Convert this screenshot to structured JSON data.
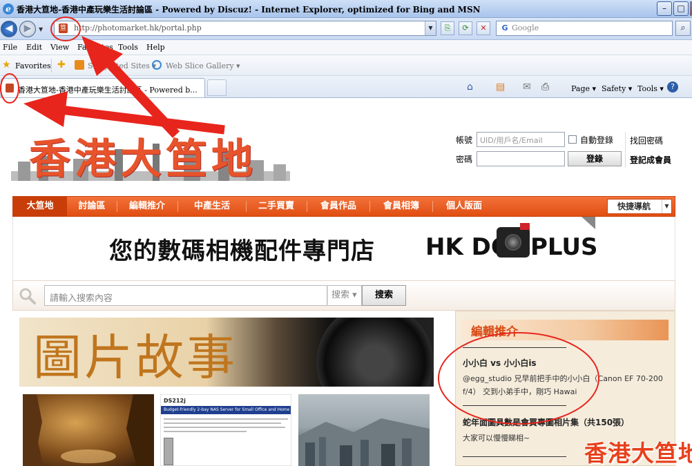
{
  "window": {
    "title": "香港大笪地-香港中產玩樂生活討論區 - Powered by Discuz! - Internet Explorer, optimized for Bing and MSN"
  },
  "address": {
    "url": "http://photomarket.hk/portal.php",
    "search_placeholder": "Google"
  },
  "menu": [
    "File",
    "Edit",
    "View",
    "Favorites",
    "Tools",
    "Help"
  ],
  "favorites_bar": {
    "favorites_label": "Favorites",
    "suggested_label": "Suggested Sites ▾",
    "webslice_label": "Web Slice Gallery ▾"
  },
  "tab": {
    "label": "香港大笪地-香港中產玩樂生活討論區 - Powered b..."
  },
  "command_bar": {
    "page": "Page ▾",
    "safety": "Safety ▾",
    "tools": "Tools ▾"
  },
  "site": {
    "logo_text": "香港大笪地",
    "login": {
      "account_label": "帳號",
      "account_placeholder": "UID/用戶名/Email",
      "auto_login": "自動登錄",
      "forgot": "找回密碼",
      "password_label": "密碼",
      "login_button": "登錄",
      "register": "登記成會員"
    },
    "nav": [
      "大笪地",
      "討論區",
      "編輯推介",
      "中產生活",
      "二手買賣",
      "會員作品",
      "會員相簿",
      "個人版面"
    ],
    "quick_nav": "快捷導航",
    "banner": {
      "text": "您的數碼相機配件專門店",
      "brand_left": "HK DC",
      "brand_right": "PLUS"
    },
    "search": {
      "placeholder": "請輸入搜索內容",
      "type": "搜索",
      "submit": "搜索"
    },
    "story_title": "圖片故事",
    "nas_thumb": {
      "model": "DS212j",
      "tagline": "Budget-friendly 2-bay NAS Server for Small Office and Home"
    },
    "sidebar": {
      "heading": "編輯推介",
      "items": [
        {
          "title": "小小白 vs 小小白is",
          "desc": "@egg_studio 兄早前把手中的小小白（Canon EF 70-200 f/4） 交到小弟手中，剛巧 Hawai"
        },
        {
          "title": "蛇年面圖具數是會買專圖相片集（共150張）",
          "desc": "大家可以慢慢睇相~"
        }
      ]
    },
    "watermark": "香港大笪地"
  }
}
